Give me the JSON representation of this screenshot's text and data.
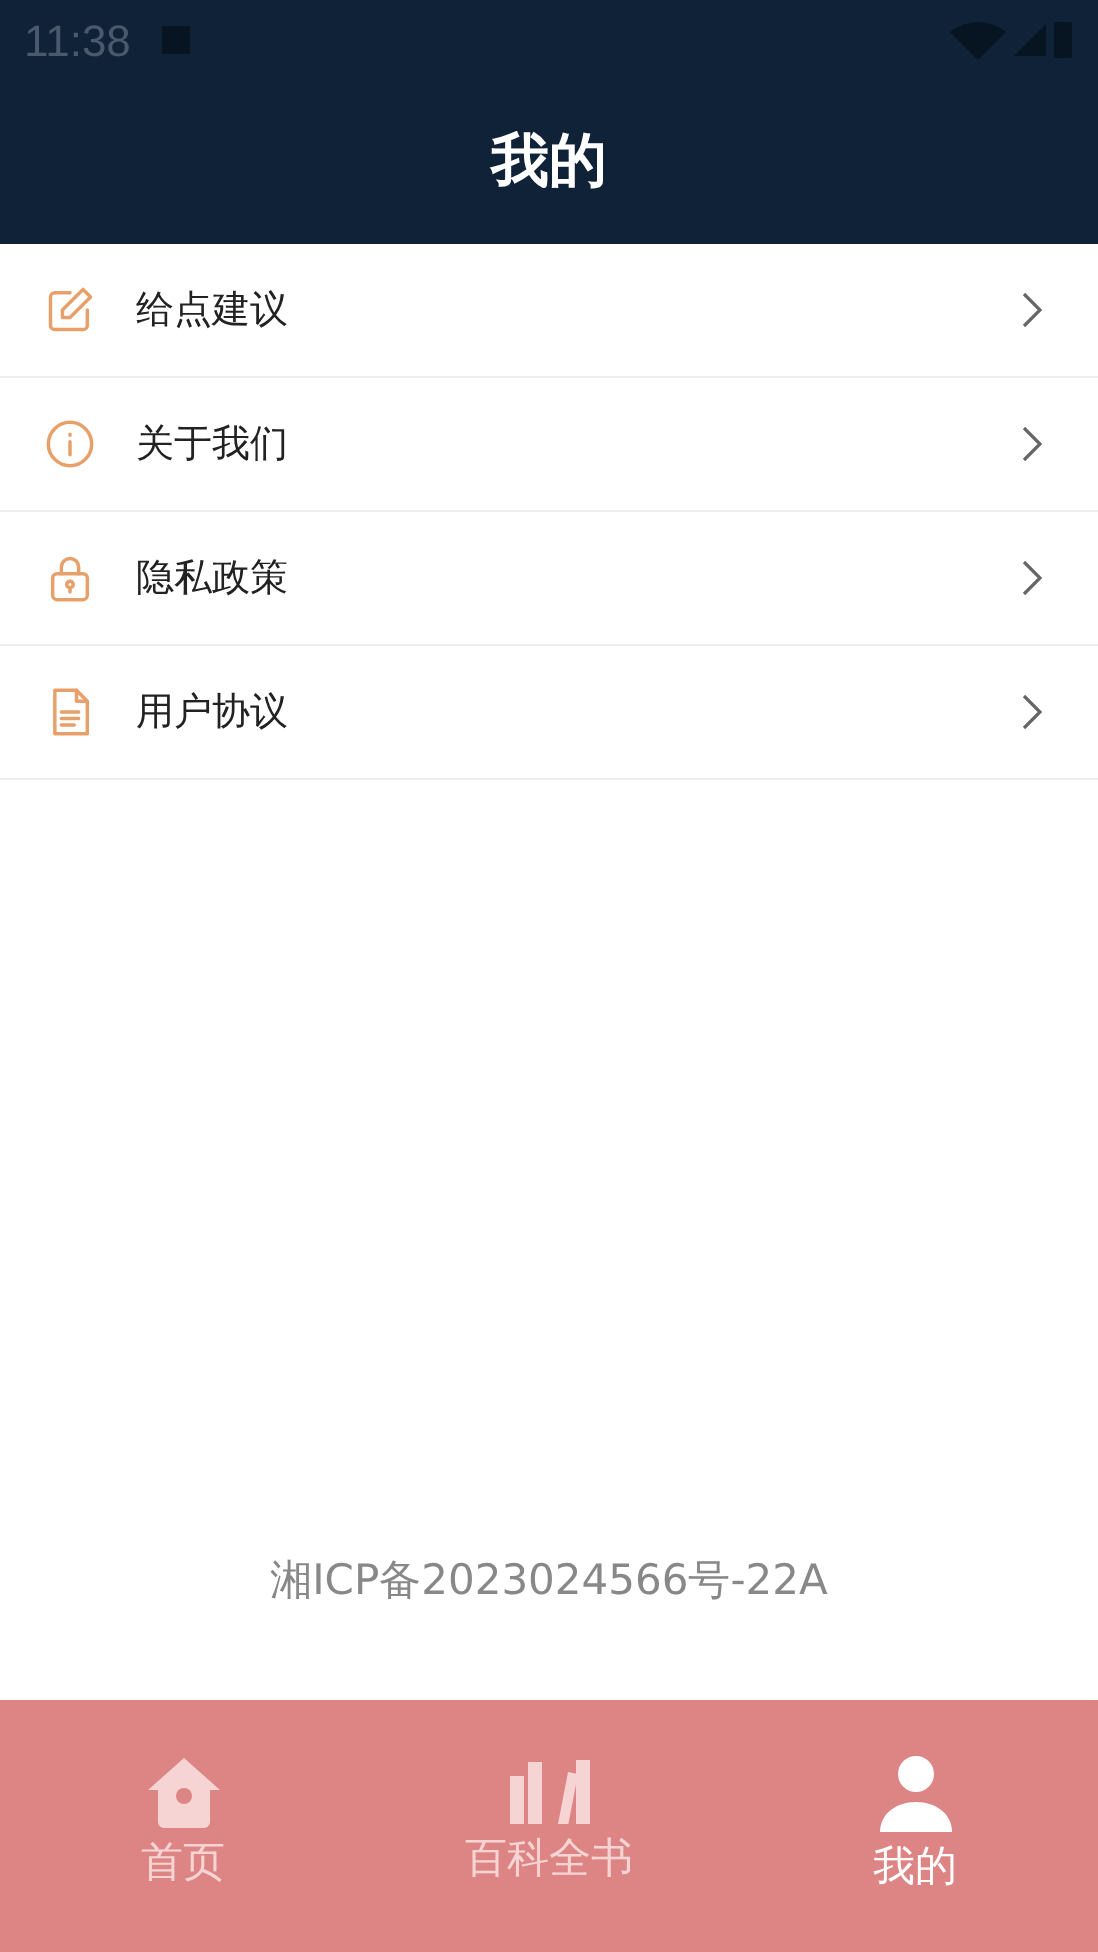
{
  "status_bar": {
    "time": "11:38"
  },
  "header": {
    "title": "我的"
  },
  "menu": [
    {
      "label": "给点建议"
    },
    {
      "label": "关于我们"
    },
    {
      "label": "隐私政策"
    },
    {
      "label": "用户协议"
    }
  ],
  "footer": {
    "icp": "湘ICP备2023024566号-22A"
  },
  "tabs": [
    {
      "label": "首页",
      "selected": false
    },
    {
      "label": "百科全书",
      "selected": false
    },
    {
      "label": "我的",
      "selected": true
    }
  ]
}
